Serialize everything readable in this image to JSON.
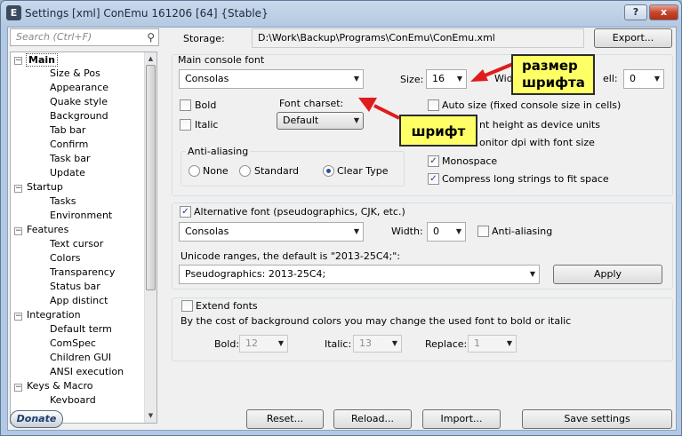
{
  "window": {
    "title": "Settings [xml] ConEmu 161206 [64] {Stable}",
    "help_label": "?",
    "close_label": "x",
    "app_icon": "E"
  },
  "search": {
    "placeholder": "Search (Ctrl+F)"
  },
  "tree": {
    "main": "Main",
    "size_pos": "Size & Pos",
    "appearance": "Appearance",
    "quake": "Quake style",
    "background": "Background",
    "tabbar": "Tab bar",
    "confirm": "Confirm",
    "taskbar": "Task bar",
    "update": "Update",
    "startup": "Startup",
    "tasks": "Tasks",
    "environment": "Environment",
    "features": "Features",
    "textcursor": "Text cursor",
    "colors": "Colors",
    "transparency": "Transparency",
    "statusbar": "Status bar",
    "appdistinct": "App distinct",
    "integration": "Integration",
    "defaultterm": "Default term",
    "comspec": "ComSpec",
    "childrengui": "Children GUI",
    "ansi": "ANSI execution",
    "keys": "Keys & Macro",
    "keyboard": "Keyboard"
  },
  "storage": {
    "label": "Storage:",
    "path": "D:\\Work\\Backup\\Programs\\ConEmu\\ConEmu.xml",
    "export": "Export..."
  },
  "main_font": {
    "group": "Main console font",
    "font": "Consolas",
    "size_label": "Size:",
    "size": "16",
    "width_label": "Widt",
    "cell_label": "ell:",
    "cell": "0",
    "bold": "Bold",
    "italic": "Italic",
    "charset_label": "Font charset:",
    "charset": "Default",
    "autosize": "Auto size (fixed console size in cells)",
    "heightdev": "nt height as device units",
    "monitordpi": "onitor dpi with font size",
    "monospace": "Monospace",
    "compress": "Compress long strings to fit space",
    "aa_label": "Anti-aliasing",
    "aa_none": "None",
    "aa_standard": "Standard",
    "aa_cleartype": "Clear Type"
  },
  "alt_font": {
    "label": "Alternative font (pseudographics, CJK, etc.)",
    "font": "Consolas",
    "width_label": "Width:",
    "width": "0",
    "aa": "Anti-aliasing",
    "unicode_label": "Unicode ranges, the default is \"2013-25C4;\":",
    "unicode": "Pseudographics: 2013-25C4;",
    "apply": "Apply"
  },
  "extend": {
    "label": "Extend fonts",
    "desc": "By the cost of background colors you may change the used font to bold or italic",
    "bold_label": "Bold:",
    "bold": "12",
    "italic_label": "Italic:",
    "italic": "13",
    "replace_label": "Replace:",
    "replace": "1"
  },
  "bottom": {
    "donate": "Donate",
    "reset": "Reset...",
    "reload": "Reload...",
    "import": "Import...",
    "save": "Save settings"
  },
  "callouts": {
    "size": "размер\nшрифта",
    "font": "шрифт"
  },
  "colors": {
    "callout_bg": "#ffff66",
    "arrow": "#e01b1b"
  }
}
